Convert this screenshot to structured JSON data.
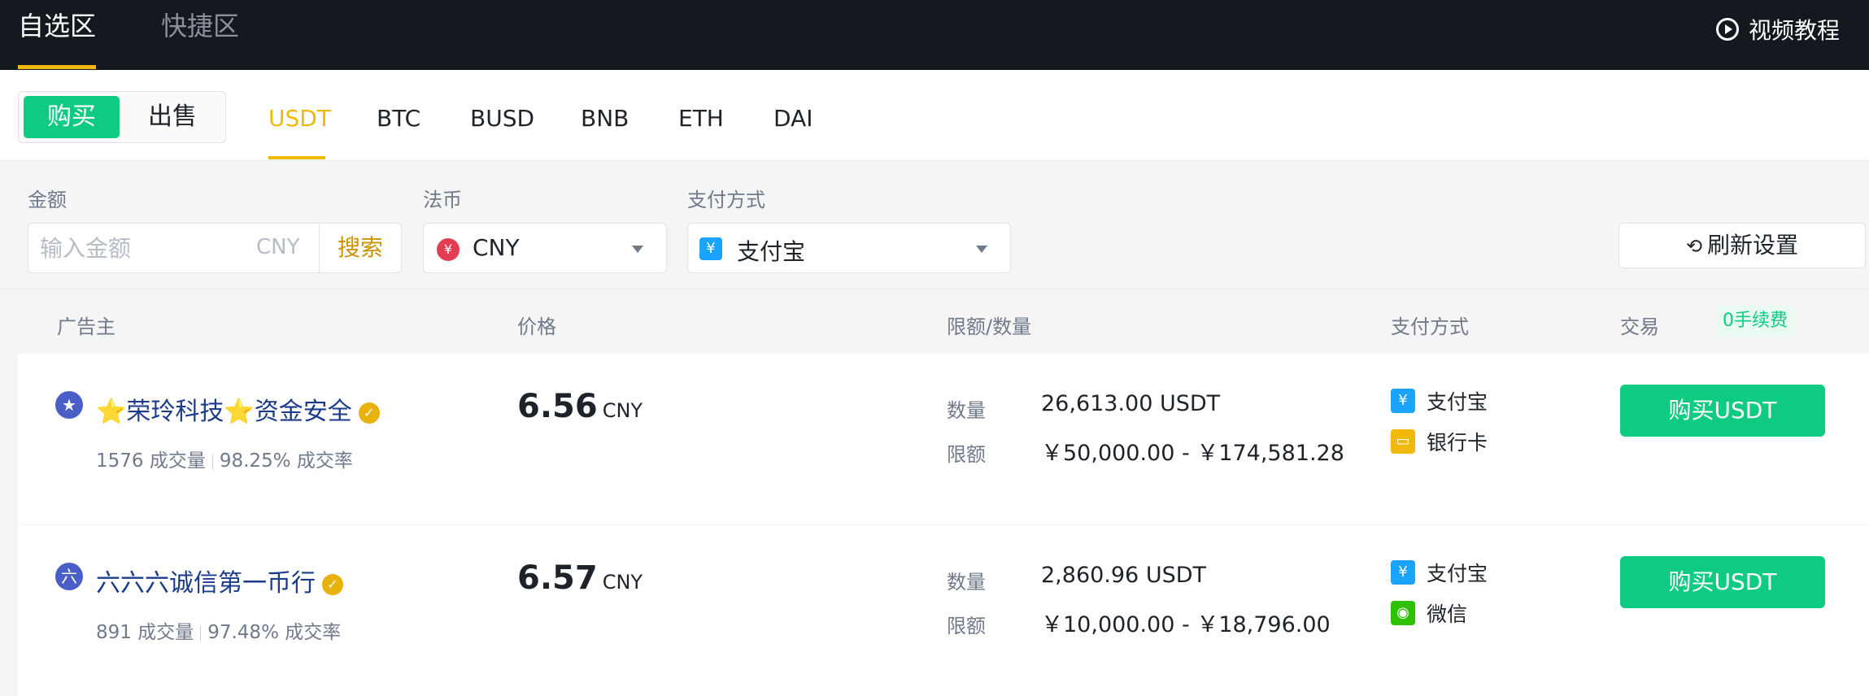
{
  "topbar": {
    "tab_active": "自选区",
    "tab_inactive": "快捷区",
    "video_label": "视频教程"
  },
  "side": {
    "buy": "购买",
    "sell": "出售"
  },
  "coins": [
    "USDT",
    "BTC",
    "BUSD",
    "BNB",
    "ETH",
    "DAI"
  ],
  "filters": {
    "amount_label": "金额",
    "amount_placeholder": "输入金额",
    "amount_unit": "CNY",
    "search_label": "搜索",
    "fiat_label": "法币",
    "fiat_value": "CNY",
    "payment_label": "支付方式",
    "payment_value": "支付宝",
    "refresh_label": "刷新设置"
  },
  "table": {
    "headers": {
      "advertiser": "广告主",
      "price": "价格",
      "limit": "限额/数量",
      "payment": "支付方式",
      "trade": "交易",
      "fee_badge": "0手续费"
    },
    "rows": [
      {
        "avatar": "★",
        "name": "⭐荣玲科技⭐资金安全",
        "orders": "1576 成交量",
        "completion": "98.25% 成交率",
        "price": "6.56",
        "currency": "CNY",
        "qty_label": "数量",
        "qty_value": "26,613.00 USDT",
        "limit_label": "限额",
        "limit_value": "￥50,000.00 - ￥174,581.28",
        "payments": [
          {
            "icon": "alipay-icon",
            "label": "支付宝"
          },
          {
            "icon": "bank-card-icon",
            "label": "银行卡"
          }
        ],
        "button": "购买USDT"
      },
      {
        "avatar": "六",
        "name": "六六六诚信第一币行",
        "orders": "891 成交量",
        "completion": "97.48% 成交率",
        "price": "6.57",
        "currency": "CNY",
        "qty_label": "数量",
        "qty_value": "2,860.96 USDT",
        "limit_label": "限额",
        "limit_value": "￥10,000.00 - ￥18,796.00",
        "payments": [
          {
            "icon": "alipay-icon",
            "label": "支付宝"
          },
          {
            "icon": "wechat-icon",
            "label": "微信"
          }
        ],
        "button": "购买USDT"
      }
    ]
  },
  "colors": {
    "brand_yellow": "#f0b90b",
    "buy_green": "#0ecb81",
    "topbar_bg": "#14181f"
  }
}
